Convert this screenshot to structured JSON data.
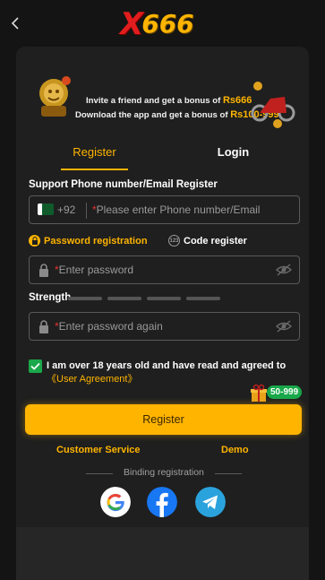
{
  "brand": {
    "logo_x": "X",
    "logo_num": "666"
  },
  "banner": {
    "line1_prefix": "Invite a friend and get a bonus of ",
    "line1_amount": "Rs666",
    "line2_prefix": "Download the app and get a bonus of ",
    "line2_amount": "Rs100-999"
  },
  "tabs": {
    "register": "Register",
    "login": "Login"
  },
  "phone": {
    "label": "Support Phone number/Email Register",
    "country_code": "+92",
    "placeholder": "Please enter Phone number/Email"
  },
  "modes": {
    "password": "Password registration",
    "code": "Code register",
    "code_icon_text": "123"
  },
  "password": {
    "placeholder": "Enter password",
    "required_mark": "*"
  },
  "strength": {
    "label": "Strength"
  },
  "password_again": {
    "placeholder": "Enter password again",
    "required_mark": "*"
  },
  "agreement": {
    "text": "I am over 18 years old and have read and agreed to ",
    "link": "《User Agreement》",
    "checked": true
  },
  "bonus": {
    "label": "50-999"
  },
  "actions": {
    "register": "Register",
    "customer_service": "Customer Service",
    "demo": "Demo"
  },
  "binding": {
    "label": "Binding registration"
  },
  "colors": {
    "accent": "#ffb400",
    "panel": "#1f1f1f",
    "check": "#1aa84a"
  },
  "icons": [
    "back-arrow-icon",
    "lock-icon",
    "eye-off-icon",
    "google-icon",
    "facebook-icon",
    "telegram-icon"
  ]
}
